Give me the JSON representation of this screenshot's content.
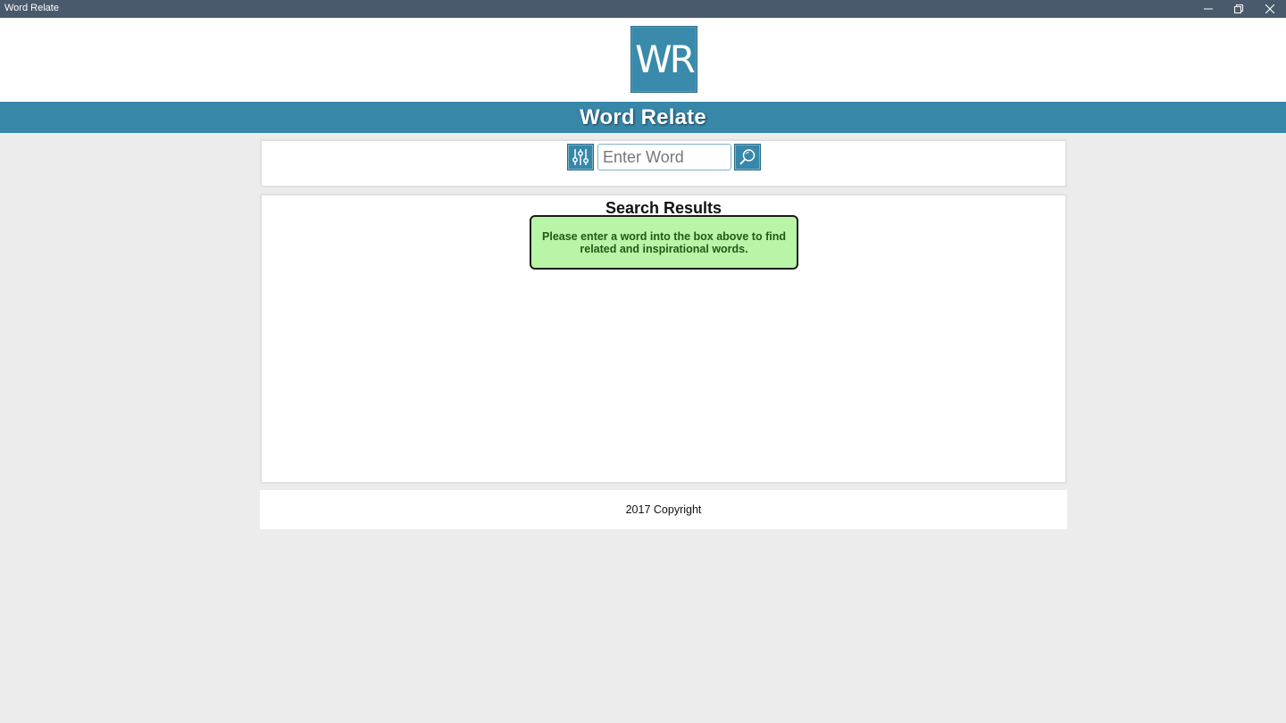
{
  "window": {
    "title": "Word Relate",
    "controls": {
      "minimize": "minimize-icon",
      "restore": "restore-icon",
      "close": "close-icon"
    }
  },
  "header": {
    "logo_text": "WR",
    "app_name": "Word Relate"
  },
  "search": {
    "placeholder": "Enter Word",
    "value": "",
    "filter_icon": "sliders-icon",
    "search_icon": "magnifier-icon"
  },
  "results": {
    "title": "Search Results",
    "message": "Please enter a word into the box above to find related and inspirational words."
  },
  "footer": {
    "copyright": "2017 Copyright"
  },
  "colors": {
    "brand": "#3787a9",
    "titlebar": "#4a5a6c",
    "info_bg": "#b8f5a6",
    "page_bg": "#ececec"
  }
}
